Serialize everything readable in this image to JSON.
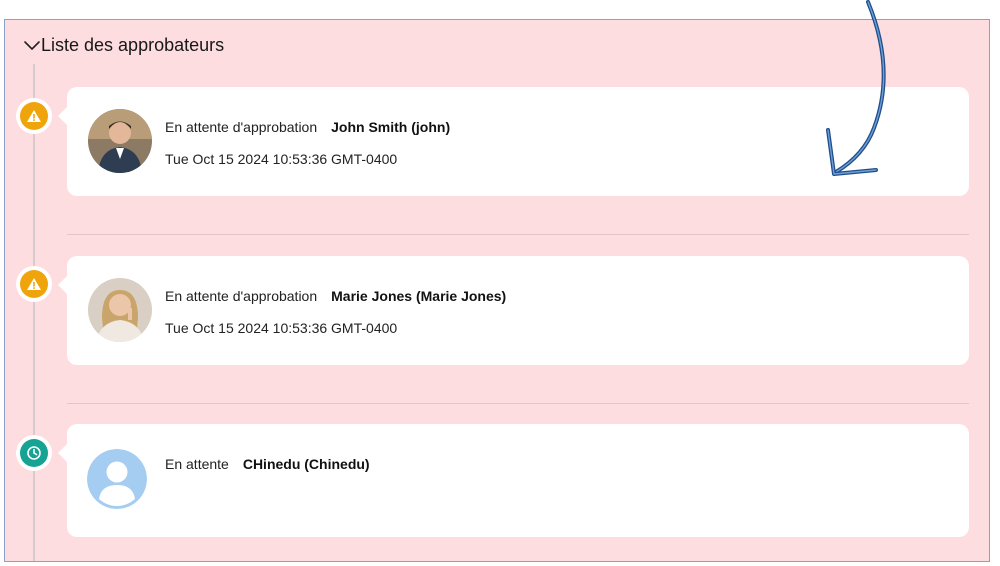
{
  "section": {
    "title": "Liste des approbateurs",
    "icon": "chevron-down-icon"
  },
  "approvers": [
    {
      "status_icon": "warning-icon",
      "status_color": "#f0a40c",
      "status_text": "En attente d'approbation",
      "name": "John Smith (john)",
      "date": "Tue Oct 15 2024 10:53:36 GMT-0400",
      "avatar": "user-photo-avatar"
    },
    {
      "status_icon": "warning-icon",
      "status_color": "#f0a40c",
      "status_text": "En attente d'approbation",
      "name": "Marie Jones (Marie Jones)",
      "date": "Tue Oct 15 2024 10:53:36 GMT-0400",
      "avatar": "user-photo-avatar"
    },
    {
      "status_icon": "clock-icon",
      "status_color": "#16a394",
      "status_text": "En attente",
      "name": "CHinedu (Chinedu)",
      "avatar": "default-user-avatar"
    }
  ],
  "colors": {
    "panel_bg": "#fddde0",
    "card_bg": "#ffffff",
    "annotation_arrow": "#1f4e8c"
  }
}
